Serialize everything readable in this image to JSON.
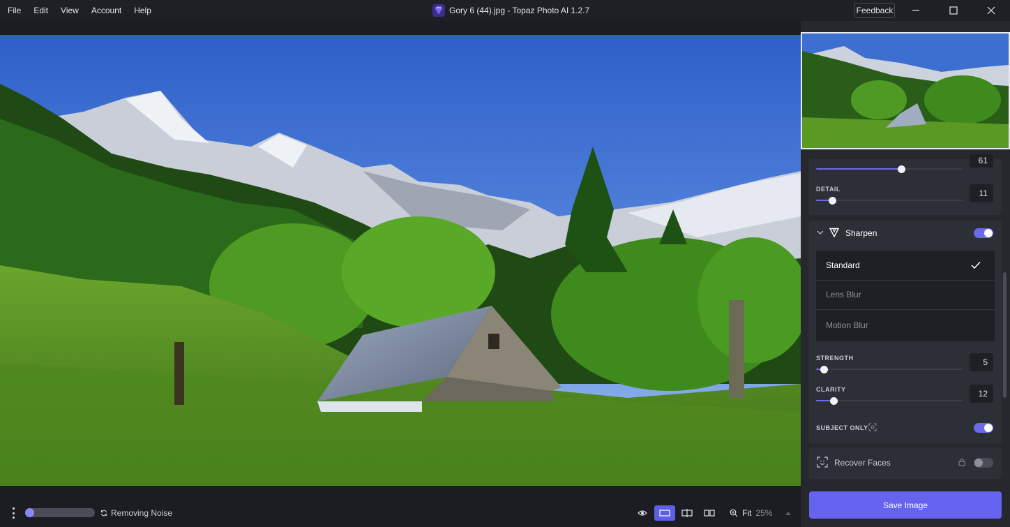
{
  "menu": [
    "File",
    "Edit",
    "View",
    "Account",
    "Help"
  ],
  "window": {
    "title": "Gory 6 (44).jpg - Topaz Photo AI 1.2.7",
    "feedback_label": "Feedback"
  },
  "status": {
    "text": "Removing Noise",
    "progress": 0.12
  },
  "zoom": {
    "label": "Fit",
    "percent": "25%"
  },
  "panel": {
    "prev_section": {
      "partial_value": "61",
      "partial_level": 0.58,
      "detail_label": "DETAIL",
      "detail_value": "11",
      "detail_level": 0.11
    },
    "sharpen": {
      "title": "Sharpen",
      "enabled": true,
      "options": [
        "Standard",
        "Lens Blur",
        "Motion Blur"
      ],
      "selected": "Standard",
      "strength_label": "STRENGTH",
      "strength_value": "5",
      "strength_level": 0.05,
      "clarity_label": "CLARITY",
      "clarity_value": "12",
      "clarity_level": 0.12,
      "subject_only_label": "SUBJECT ONLY",
      "subject_only_enabled": true
    },
    "recover_faces": {
      "title": "Recover Faces",
      "enabled": false,
      "locked": true
    },
    "save_label": "Save Image"
  },
  "colors": {
    "accent": "#6464f0",
    "background": "#1b1d22",
    "panel": "#26282e"
  }
}
